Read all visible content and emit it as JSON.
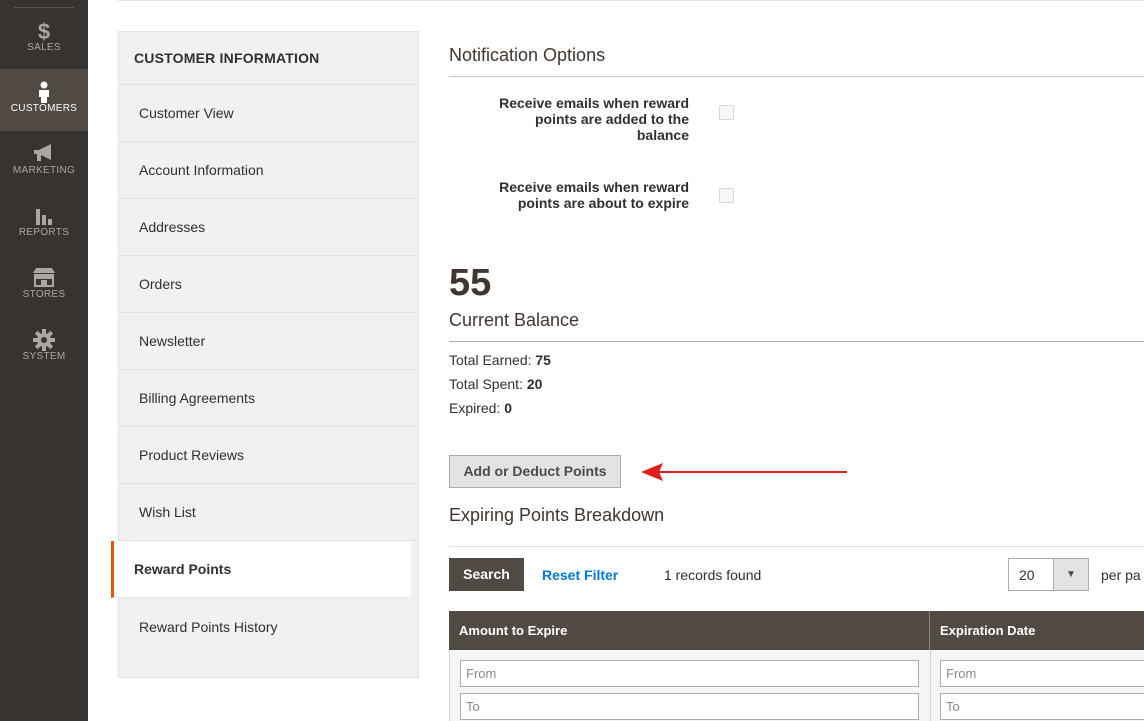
{
  "admin_menu": {
    "items": [
      {
        "label": "SALES",
        "icon": "dollar-icon"
      },
      {
        "label": "CUSTOMERS",
        "icon": "person-icon",
        "active": true
      },
      {
        "label": "MARKETING",
        "icon": "megaphone-icon"
      },
      {
        "label": "REPORTS",
        "icon": "bar-chart-icon"
      },
      {
        "label": "STORES",
        "icon": "storefront-icon"
      },
      {
        "label": "SYSTEM",
        "icon": "gear-icon"
      }
    ]
  },
  "tabs": {
    "title": "CUSTOMER INFORMATION",
    "items": [
      {
        "label": "Customer View"
      },
      {
        "label": "Account Information"
      },
      {
        "label": "Addresses"
      },
      {
        "label": "Orders"
      },
      {
        "label": "Newsletter"
      },
      {
        "label": "Billing Agreements"
      },
      {
        "label": "Product Reviews"
      },
      {
        "label": "Wish List"
      },
      {
        "label": "Reward Points",
        "active": true
      },
      {
        "label": "Reward Points History"
      }
    ]
  },
  "notifications": {
    "title": "Notification Options",
    "option1_line1": "Receive emails when reward",
    "option1_line2": "points are added to the",
    "option1_line3": "balance",
    "option2_line1": "Receive emails when reward",
    "option2_line2": "points are about to expire",
    "option1_checked": false,
    "option2_checked": false
  },
  "balance": {
    "value": "55",
    "label": "Current Balance",
    "earned_label": "Total Earned:",
    "earned_value": "75",
    "spent_label": "Total Spent:",
    "spent_value": "20",
    "expired_label": "Expired:",
    "expired_value": "0"
  },
  "actions": {
    "add_deduct": "Add or Deduct Points"
  },
  "breakdown": {
    "title": "Expiring Points Breakdown",
    "search_label": "Search",
    "reset_label": "Reset Filter",
    "records": "1 records found",
    "per_page_value": "20",
    "per_page_label": "per pa",
    "columns": [
      "Amount to Expire",
      "Expiration Date"
    ],
    "filter_from": "From",
    "filter_to": "To"
  },
  "colors": {
    "menu_bg": "#373330",
    "menu_active": "#514943",
    "accent": "#eb5202",
    "link": "#007bdb",
    "arrow": "#e02020"
  }
}
